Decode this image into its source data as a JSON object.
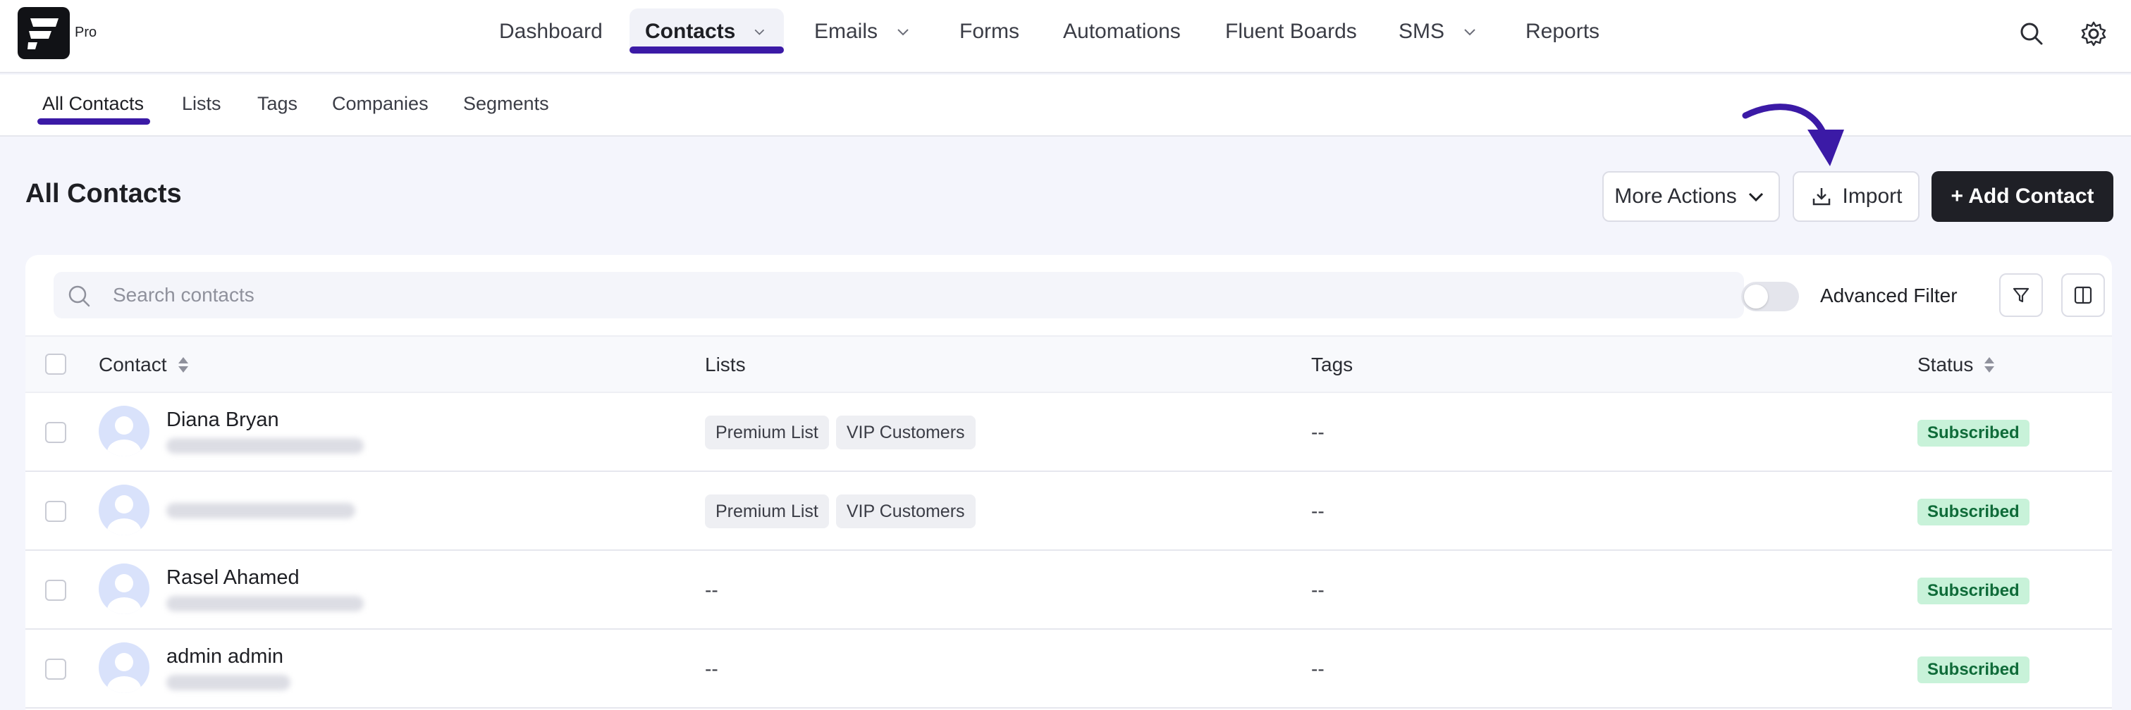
{
  "brand": {
    "badge": "Pro"
  },
  "nav": {
    "items": [
      {
        "label": "Dashboard"
      },
      {
        "label": "Contacts"
      },
      {
        "label": "Emails"
      },
      {
        "label": "Forms"
      },
      {
        "label": "Automations"
      },
      {
        "label": "Fluent Boards"
      },
      {
        "label": "SMS"
      },
      {
        "label": "Reports"
      }
    ],
    "active": "Contacts"
  },
  "subnav": {
    "items": [
      {
        "label": "All Contacts"
      },
      {
        "label": "Lists"
      },
      {
        "label": "Tags"
      },
      {
        "label": "Companies"
      },
      {
        "label": "Segments"
      }
    ],
    "active": "All Contacts"
  },
  "page": {
    "title": "All Contacts",
    "more_actions_label": "More Actions",
    "import_label": "Import",
    "add_contact_label": "+ Add Contact"
  },
  "filters": {
    "search_placeholder": "Search contacts",
    "advanced_filter_label": "Advanced Filter",
    "advanced_filter_on": false
  },
  "table": {
    "columns": [
      "Contact",
      "Lists",
      "Tags",
      "Status"
    ],
    "rows": [
      {
        "name": "Diana Bryan",
        "lists": [
          "Premium List",
          "VIP Customers"
        ],
        "tags": "--",
        "status": "Subscribed"
      },
      {
        "name": "",
        "lists": [
          "Premium List",
          "VIP Customers"
        ],
        "tags": "--",
        "status": "Subscribed"
      },
      {
        "name": "Rasel Ahamed",
        "lists": [],
        "lists_empty": "--",
        "tags": "--",
        "status": "Subscribed"
      },
      {
        "name": "admin admin",
        "lists": [],
        "lists_empty": "--",
        "tags": "--",
        "status": "Subscribed"
      }
    ]
  },
  "colors": {
    "accent": "#3b1aa6",
    "dark_button": "#1f2026",
    "status_bg": "#c8f2d9",
    "status_text": "#0f6b39"
  },
  "icons": [
    "logo-icon",
    "chevron-down-icon",
    "search-icon",
    "gear-icon",
    "download-icon",
    "plus-icon",
    "filter-icon",
    "columns-icon",
    "sort-icon",
    "avatar-icon",
    "arrow-annotation-icon"
  ]
}
